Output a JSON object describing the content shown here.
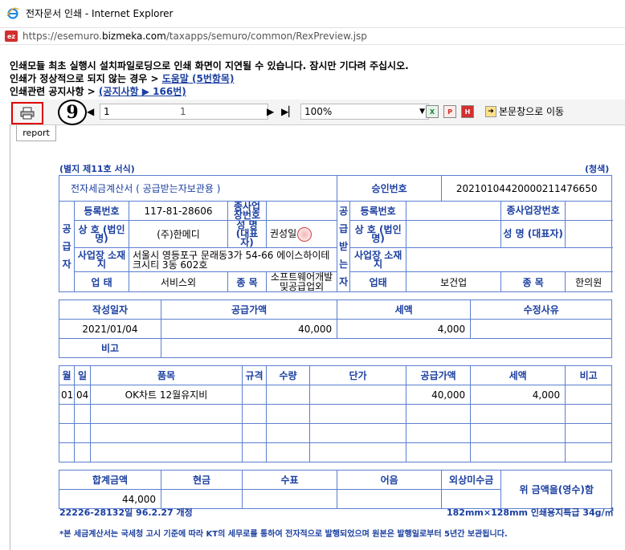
{
  "window": {
    "title": "전자문서 인쇄 - Internet Explorer",
    "url_prefix": "https://esemuro.",
    "url_host": "bizmeka.com",
    "url_path": "/taxapps/semuro/common/RexPreview.jsp",
    "ez_badge": "ez"
  },
  "notice": {
    "line1": "인쇄모듈 최초 실행시 설치파일로딩으로 인쇄 화면이 지연될 수 있습니다. 잠시만 기다려 주십시오.",
    "line2_prefix": "인쇄가 정상적으로 되지 않는 경우 > ",
    "line2_link": "도움말 (5번항목)",
    "line3_prefix": "인쇄관련 공지사항 > ",
    "line3_link": "(공지사항 ▶ 166번)"
  },
  "toolbar": {
    "step_number": "9",
    "page_current": "1",
    "page_total": "1",
    "zoom": "100%",
    "move_label": "본문창으로 이동",
    "excel_icon": "X",
    "pdf_icon": "P",
    "hwp_icon": "H"
  },
  "tab": {
    "label": "report"
  },
  "invoice": {
    "form_no": "(별지 제11호 서식)",
    "copy_type": "(청색)",
    "title": "전자세금계산서 ( 공급받는자보관용 )",
    "approval_label": "승인번호",
    "approval_no": "20210104420000211476650",
    "supplier_label": "공급자",
    "buyer_label": "공급받는자",
    "reg_no_label": "등록번호",
    "sub_biz_label": "종사업장번호",
    "name_label": "상 호 (법인명)",
    "ceo_label": "성 명 (대표자)",
    "addr_label": "사업장 소재지",
    "type_label": "업 태",
    "item_label": "종 목",
    "supplier": {
      "reg_no": "117-81-28606",
      "sub_biz": "",
      "name": "(주)한메디",
      "ceo": "권성일",
      "addr": "서울시 영등포구 문래동3가 54-66 에이스하이테크시티 3동 602호",
      "type": "서비스외",
      "item": "소프트웨어개발 및공급업외"
    },
    "buyer": {
      "reg_no": "",
      "sub_biz": "",
      "name": "",
      "ceo": "",
      "addr": "",
      "type": "보건업",
      "item": "한의원"
    },
    "buyer_type_label": "업태",
    "date_label": "작성일자",
    "supply_label": "공급가액",
    "tax_label": "세액",
    "reason_label": "수정사유",
    "date": "2021/01/04",
    "supply": "40,000",
    "tax": "4,000",
    "reason": "",
    "remark_label": "비고",
    "remark": "",
    "items_header": {
      "month": "월",
      "day": "일",
      "name": "품목",
      "spec": "규격",
      "qty": "수량",
      "unit": "단가",
      "supply": "공급가액",
      "tax": "세액",
      "note": "비고"
    },
    "items": [
      {
        "month": "01",
        "day": "04",
        "name": "OK차트 12월유지비",
        "spec": "",
        "qty": "",
        "unit": "",
        "supply": "40,000",
        "tax": "4,000",
        "note": ""
      }
    ],
    "totals_header": {
      "total": "합계금액",
      "cash": "현금",
      "check": "수표",
      "note": "어음",
      "credit": "외상미수금"
    },
    "total": "44,000",
    "receipt_text": "위 금액을(영수)함",
    "form_code": "22226-28132일 96.2.27 개정",
    "paper_spec": "182mm×128mm 인쇄용지특급 34g/㎡",
    "footnote": "*본 세금계산서는 국세청 고시 기준에 따라 KT의 세무로를 통하여 전자적으로 발행되었으며 원본은 발행일로부터 5년간 보관됩니다."
  }
}
